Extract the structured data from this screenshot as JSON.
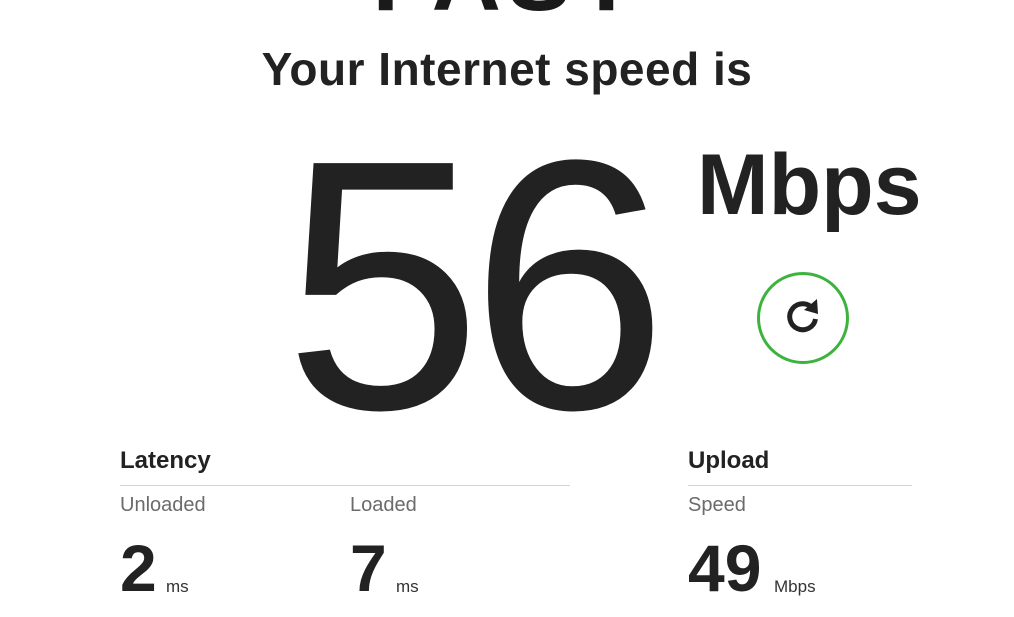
{
  "logo": {
    "text": "FAST"
  },
  "headline": "Your Internet speed is",
  "download": {
    "value": "56",
    "unit": "Mbps"
  },
  "refresh": {
    "icon": "refresh-icon",
    "ring_color": "#3db33d"
  },
  "latency": {
    "title": "Latency",
    "unloaded": {
      "label": "Unloaded",
      "value": "2",
      "unit": "ms"
    },
    "loaded": {
      "label": "Loaded",
      "value": "7",
      "unit": "ms"
    }
  },
  "upload": {
    "title": "Upload",
    "speed": {
      "label": "Speed",
      "value": "49",
      "unit": "Mbps"
    }
  }
}
